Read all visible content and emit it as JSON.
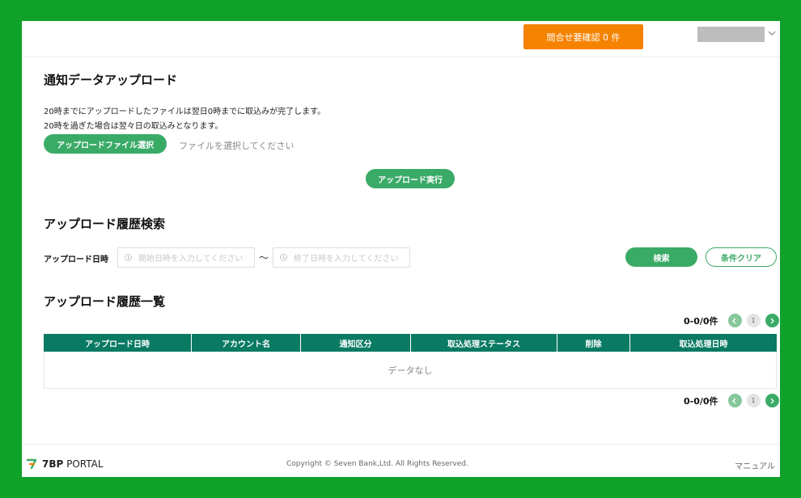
{
  "header": {
    "inquiry_button": "問合せ要確認 0 件"
  },
  "upload": {
    "title": "通知データアップロード",
    "note_1": "20時までにアップロードしたファイルは翌日0時までに取込みが完了します。",
    "note_2": "20時を過ぎた場合は翌々日の取込みとなります。",
    "select_button": "アップロードファイル選択",
    "file_placeholder": "ファイルを選択してください",
    "execute_button": "アップロード実行"
  },
  "search": {
    "title": "アップロード履歴検索",
    "date_label": "アップロード日時",
    "start_placeholder": "開始日時を入力してください",
    "separator": "～",
    "end_placeholder": "終了日時を入力してください",
    "search_button": "検索",
    "clear_button": "条件クリア"
  },
  "history": {
    "title": "アップロード履歴一覧",
    "count_top": "0-0/0件",
    "count_bottom": "0-0/0件",
    "page": "1",
    "columns": [
      "アップロード日時",
      "アカウント名",
      "通知区分",
      "取込処理ステータス",
      "削除",
      "取込処理日時"
    ],
    "empty_text": "データなし"
  },
  "footer": {
    "logo_bold": "7BP",
    "logo_rest": " PORTAL",
    "copyright": "Copyright © Seven Bank,Ltd. All Rights Reserved.",
    "manual_link": "マニュアル"
  },
  "colors": {
    "brand_green": "#3aaa67",
    "table_header": "#0a7a63",
    "accent_orange": "#f58300",
    "frame_green": "#0fa12a"
  }
}
